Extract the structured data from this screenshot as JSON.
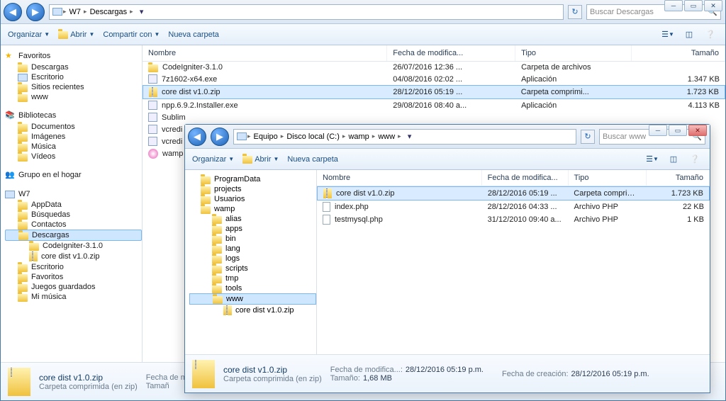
{
  "outer": {
    "breadcrumb": [
      "W7",
      "Descargas"
    ],
    "search_placeholder": "Buscar Descargas",
    "toolbar": {
      "organize": "Organizar",
      "open": "Abrir",
      "share": "Compartir con",
      "newfolder": "Nueva carpeta"
    },
    "columns": {
      "name": "Nombre",
      "date": "Fecha de modifica...",
      "type": "Tipo",
      "size": "Tamaño"
    },
    "tree": {
      "favorites": "Favoritos",
      "fav_items": [
        "Descargas",
        "Escritorio",
        "Sitios recientes",
        "www"
      ],
      "libraries": "Bibliotecas",
      "lib_items": [
        "Documentos",
        "Imágenes",
        "Música",
        "Vídeos"
      ],
      "homegroup": "Grupo en el hogar",
      "computer": "W7",
      "comp_items": [
        "AppData",
        "Búsquedas",
        "Contactos",
        "Descargas",
        "CodeIgniter-3.1.0",
        "core dist v1.0.zip",
        "Escritorio",
        "Favoritos",
        "Juegos guardados",
        "Mi música"
      ]
    },
    "files": [
      {
        "icon": "folder",
        "name": "CodeIgniter-3.1.0",
        "date": "26/07/2016 12:36 ...",
        "type": "Carpeta de archivos",
        "size": ""
      },
      {
        "icon": "app",
        "name": "7z1602-x64.exe",
        "date": "04/08/2016 02:02 ...",
        "type": "Aplicación",
        "size": "1.347 KB"
      },
      {
        "icon": "zip",
        "name": "core dist v1.0.zip",
        "date": "28/12/2016 05:19 ...",
        "type": "Carpeta comprimi...",
        "size": "1.723 KB",
        "selected": true
      },
      {
        "icon": "app",
        "name": "npp.6.9.2.Installer.exe",
        "date": "29/08/2016 08:40 a...",
        "type": "Aplicación",
        "size": "4.113 KB"
      },
      {
        "icon": "app",
        "name": "Sublim",
        "date": "",
        "type": "",
        "size": ""
      },
      {
        "icon": "app",
        "name": "vcredi",
        "date": "",
        "type": "",
        "size": ""
      },
      {
        "icon": "app",
        "name": "vcredi",
        "date": "",
        "type": "",
        "size": ""
      },
      {
        "icon": "pink",
        "name": "wamp",
        "date": "",
        "type": "",
        "size": ""
      }
    ],
    "details": {
      "filename": "core dist v1.0.zip",
      "subtitle": "Carpeta comprimida (en zip)",
      "mod_label": "Fecha de m",
      "size_label": "Tamañ"
    }
  },
  "inner": {
    "breadcrumb": [
      "Equipo",
      "Disco local (C:)",
      "wamp",
      "www"
    ],
    "search_placeholder": "Buscar www",
    "toolbar": {
      "organize": "Organizar",
      "open": "Abrir",
      "newfolder": "Nueva carpeta"
    },
    "columns": {
      "name": "Nombre",
      "date": "Fecha de modifica...",
      "type": "Tipo",
      "size": "Tamaño"
    },
    "tree": {
      "items": [
        "ProgramData",
        "projects",
        "Usuarios",
        "wamp"
      ],
      "wamp_items": [
        "alias",
        "apps",
        "bin",
        "lang",
        "logs",
        "scripts",
        "tmp",
        "tools",
        "www"
      ],
      "www_items": [
        "core dist v1.0.zip"
      ]
    },
    "files": [
      {
        "icon": "zip",
        "name": "core dist v1.0.zip",
        "date": "28/12/2016 05:19 ...",
        "type": "Carpeta comprimi...",
        "size": "1.723 KB",
        "selected": true
      },
      {
        "icon": "file",
        "name": "index.php",
        "date": "28/12/2016 04:33 ...",
        "type": "Archivo PHP",
        "size": "22 KB"
      },
      {
        "icon": "file",
        "name": "testmysql.php",
        "date": "31/12/2010 09:40 a...",
        "type": "Archivo PHP",
        "size": "1 KB"
      }
    ],
    "details": {
      "filename": "core dist v1.0.zip",
      "subtitle": "Carpeta comprimida (en zip)",
      "mod_label": "Fecha de modifica...:",
      "mod_value": "28/12/2016 05:19 p.m.",
      "created_label": "Fecha de creación:",
      "created_value": "28/12/2016 05:19 p.m.",
      "size_label": "Tamaño:",
      "size_value": "1,68 MB"
    }
  }
}
